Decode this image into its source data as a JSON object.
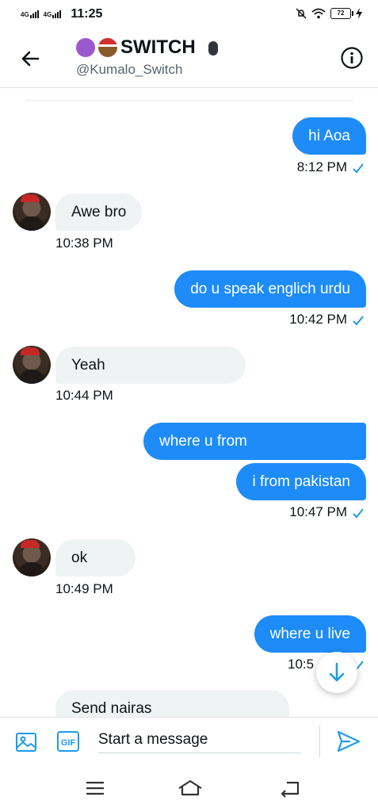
{
  "status_bar": {
    "net1": "4G",
    "net2": "4G",
    "time": "11:25",
    "battery": "72"
  },
  "header": {
    "title": "SWITCH",
    "handle": "@Kumalo_Switch"
  },
  "messages": [
    {
      "text": "hi Aoa",
      "time": "8:12 PM"
    },
    {
      "text": "Awe bro",
      "time": "10:38 PM"
    },
    {
      "text": "do u speak englich urdu",
      "time": "10:42 PM"
    },
    {
      "text": "Yeah",
      "time": "10:44 PM"
    },
    {
      "text": "where u from"
    },
    {
      "text": "i from pakistan",
      "time": "10:47 PM"
    },
    {
      "text": "ok",
      "time": "10:49 PM"
    },
    {
      "text": "where u live",
      "time": "10:5"
    },
    {
      "text": "Send nairas"
    }
  ],
  "composer": {
    "placeholder": "Start a message",
    "gif_label": "GIF"
  },
  "icons": {
    "back": "arrow-left-icon",
    "info": "info-icon",
    "read": "check-icon",
    "scroll": "arrow-down-icon",
    "image": "image-icon",
    "send": "send-icon",
    "menu": "menu-icon",
    "home": "home-icon",
    "return": "back-icon"
  },
  "colors": {
    "accent": "#1d9bf0",
    "sent_bubble": "#1d8cf8",
    "received_bubble": "#eff3f4"
  }
}
